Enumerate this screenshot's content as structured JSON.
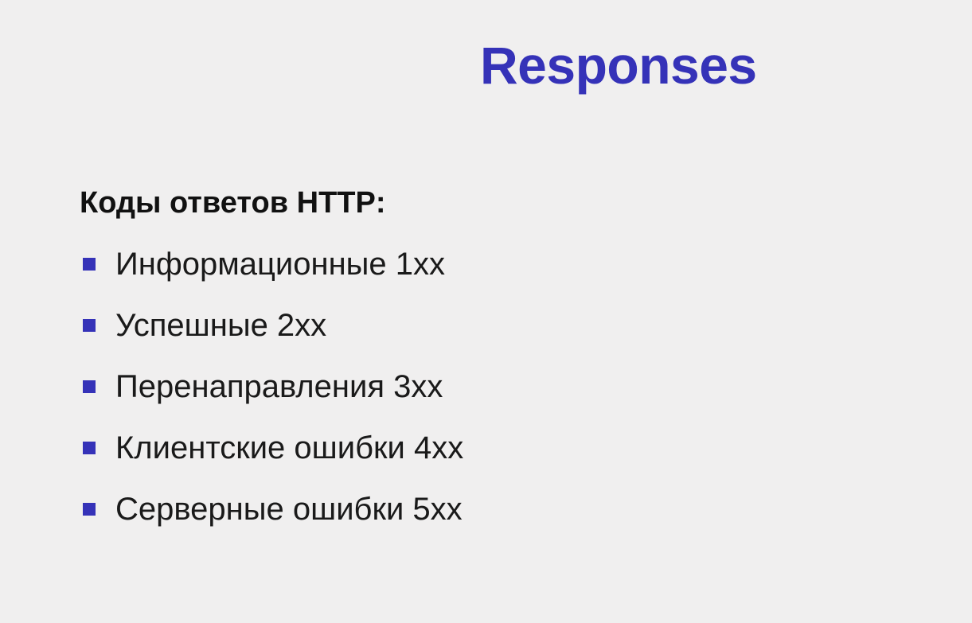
{
  "slide": {
    "title": "Responses",
    "heading": "Коды ответов HTTP:",
    "items": [
      {
        "label": "Информационные 1xx"
      },
      {
        "label": "Успешные 2xx"
      },
      {
        "label": "Перенаправления 3xx"
      },
      {
        "label": "Клиентские ошибки 4xx"
      },
      {
        "label": "Серверные ошибки 5xx"
      }
    ]
  },
  "colors": {
    "background": "#f0efef",
    "accent": "#3532b8",
    "text": "#1a1a1a"
  },
  "icons": {
    "bullet": "square-bullet-icon"
  }
}
